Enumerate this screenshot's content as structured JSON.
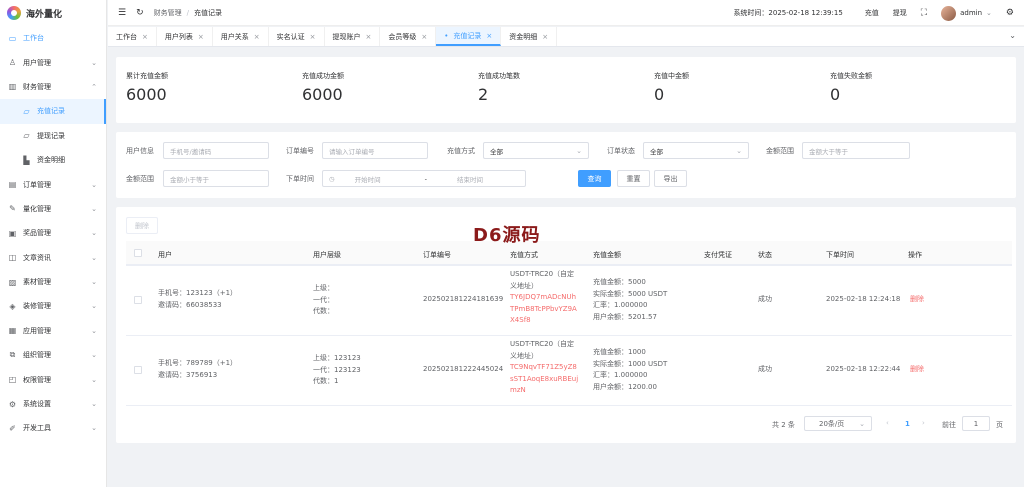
{
  "app": {
    "title": "海外量化"
  },
  "sidebar": {
    "items": [
      {
        "label": "工作台",
        "icon": "monitor-icon",
        "glyph": "▭",
        "active": true
      },
      {
        "label": "用户管理",
        "icon": "user-icon",
        "glyph": "♙",
        "arrow": "⌄"
      },
      {
        "label": "财务管理",
        "icon": "chart-icon",
        "glyph": "▥",
        "arrow": "⌃"
      },
      {
        "label": "充值记录",
        "icon": "folder-icon",
        "glyph": "▱",
        "sub": true,
        "selected": true
      },
      {
        "label": "提现记录",
        "icon": "folder-icon",
        "glyph": "▱",
        "sub": true
      },
      {
        "label": "资金明细",
        "icon": "wallet-icon",
        "glyph": "▙",
        "sub": true
      },
      {
        "label": "订单管理",
        "icon": "order-icon",
        "glyph": "▤",
        "arrow": "⌄"
      },
      {
        "label": "量化管理",
        "icon": "quant-icon",
        "glyph": "✎",
        "arrow": "⌄"
      },
      {
        "label": "奖品管理",
        "icon": "gift-icon",
        "glyph": "▣",
        "arrow": "⌄"
      },
      {
        "label": "文章资讯",
        "icon": "article-icon",
        "glyph": "◫",
        "arrow": "⌄"
      },
      {
        "label": "素材管理",
        "icon": "image-icon",
        "glyph": "▨",
        "arrow": "⌄"
      },
      {
        "label": "装修管理",
        "icon": "decor-icon",
        "glyph": "◈",
        "arrow": "⌄"
      },
      {
        "label": "应用管理",
        "icon": "app-icon",
        "glyph": "▦",
        "arrow": "⌄"
      },
      {
        "label": "组织管理",
        "icon": "org-icon",
        "glyph": "⧉",
        "arrow": "⌄"
      },
      {
        "label": "权限管理",
        "icon": "permission-icon",
        "glyph": "◰",
        "arrow": "⌄"
      },
      {
        "label": "系统设置",
        "icon": "settings-icon",
        "glyph": "⚙",
        "arrow": "⌄"
      },
      {
        "label": "开发工具",
        "icon": "dev-tool-icon",
        "glyph": "✐",
        "arrow": "⌄"
      }
    ]
  },
  "topbar": {
    "breadcrumb": [
      "财务管理",
      "充值记录"
    ],
    "system_time": "系统时间：2025-02-18 12:39:15",
    "recharge": "充值",
    "withdraw": "提现",
    "user": "admin"
  },
  "tabs": [
    {
      "label": "工作台"
    },
    {
      "label": "用户列表"
    },
    {
      "label": "用户关系"
    },
    {
      "label": "实名认证"
    },
    {
      "label": "提现账户"
    },
    {
      "label": "会员等级"
    },
    {
      "label": "充值记录",
      "active": true
    },
    {
      "label": "资金明细"
    }
  ],
  "stats": [
    {
      "label": "累计充值金额",
      "value": "6000"
    },
    {
      "label": "充值成功金额",
      "value": "6000"
    },
    {
      "label": "充值成功笔数",
      "value": "2"
    },
    {
      "label": "充值中金额",
      "value": "0"
    },
    {
      "label": "充值失败金额",
      "value": "0"
    }
  ],
  "filters": {
    "user_info_label": "用户信息",
    "user_info_placeholder": "手机号/邀请码",
    "order_no_label": "订单编号",
    "order_no_placeholder": "请输入订单编号",
    "method_label": "充值方式",
    "method_value": "全部",
    "status_label": "订单状态",
    "status_value": "全部",
    "amount_range_label": "金额范围",
    "amount_min_placeholder": "金额大于等于",
    "amount_range_label2": "金额范围",
    "amount_max_placeholder": "金额小于等于",
    "time_label": "下单时间",
    "start_placeholder": "开始时间",
    "range_sep": "-",
    "end_placeholder": "结束时间",
    "query_button": "查询",
    "reset_button": "重置",
    "export_button": "导出"
  },
  "table": {
    "delete_button": "删除",
    "columns": [
      "用户",
      "用户层级",
      "订单编号",
      "充值方式",
      "充值金额",
      "支付凭证",
      "状态",
      "下单时间",
      "操作"
    ],
    "rows": [
      {
        "user": [
          "手机号：123123（+1）",
          "邀请码：66038533"
        ],
        "level": [
          "上级：",
          "一代：",
          "代数："
        ],
        "order_no": "202502181224181639",
        "method": [
          "USDT-TRC20（自定",
          "义地址）"
        ],
        "address": [
          "TY6JDQ7mADcNUh",
          "TPmB8TcPPbvYZ9A",
          "X4Sf8"
        ],
        "amount": [
          "充值金额：5000",
          "实际金额：5000 USDT",
          "汇率：1.000000",
          "用户余额：5201.57"
        ],
        "status": "成功",
        "time": "2025-02-18 12:24:18",
        "action": "删除"
      },
      {
        "user": [
          "手机号：789789（+1）",
          "邀请码：3756913"
        ],
        "level": [
          "上级：123123",
          "一代：123123",
          "代数：1"
        ],
        "order_no": "202502181222445024",
        "method": [
          "USDT-TRC20（自定",
          "义地址）"
        ],
        "address": [
          "TC9NqvTF71Z5yZ8",
          "sST1AoqE8xuRBEuj",
          "mzN"
        ],
        "amount": [
          "充值金额：1000",
          "实际金额：1000 USDT",
          "汇率：1.000000",
          "用户余额：1200.00"
        ],
        "status": "成功",
        "time": "2025-02-18 12:22:44",
        "action": "删除"
      }
    ]
  },
  "pagination": {
    "total": "共 2 条",
    "page_size": "20条/页",
    "current_page": "1",
    "goto_label": "前往",
    "goto_value": "1",
    "page_suffix": "页"
  },
  "watermark": "D6源码",
  "colors": {
    "accent": "#409eff",
    "danger": "#f56c6c",
    "success": "#67c23a"
  }
}
